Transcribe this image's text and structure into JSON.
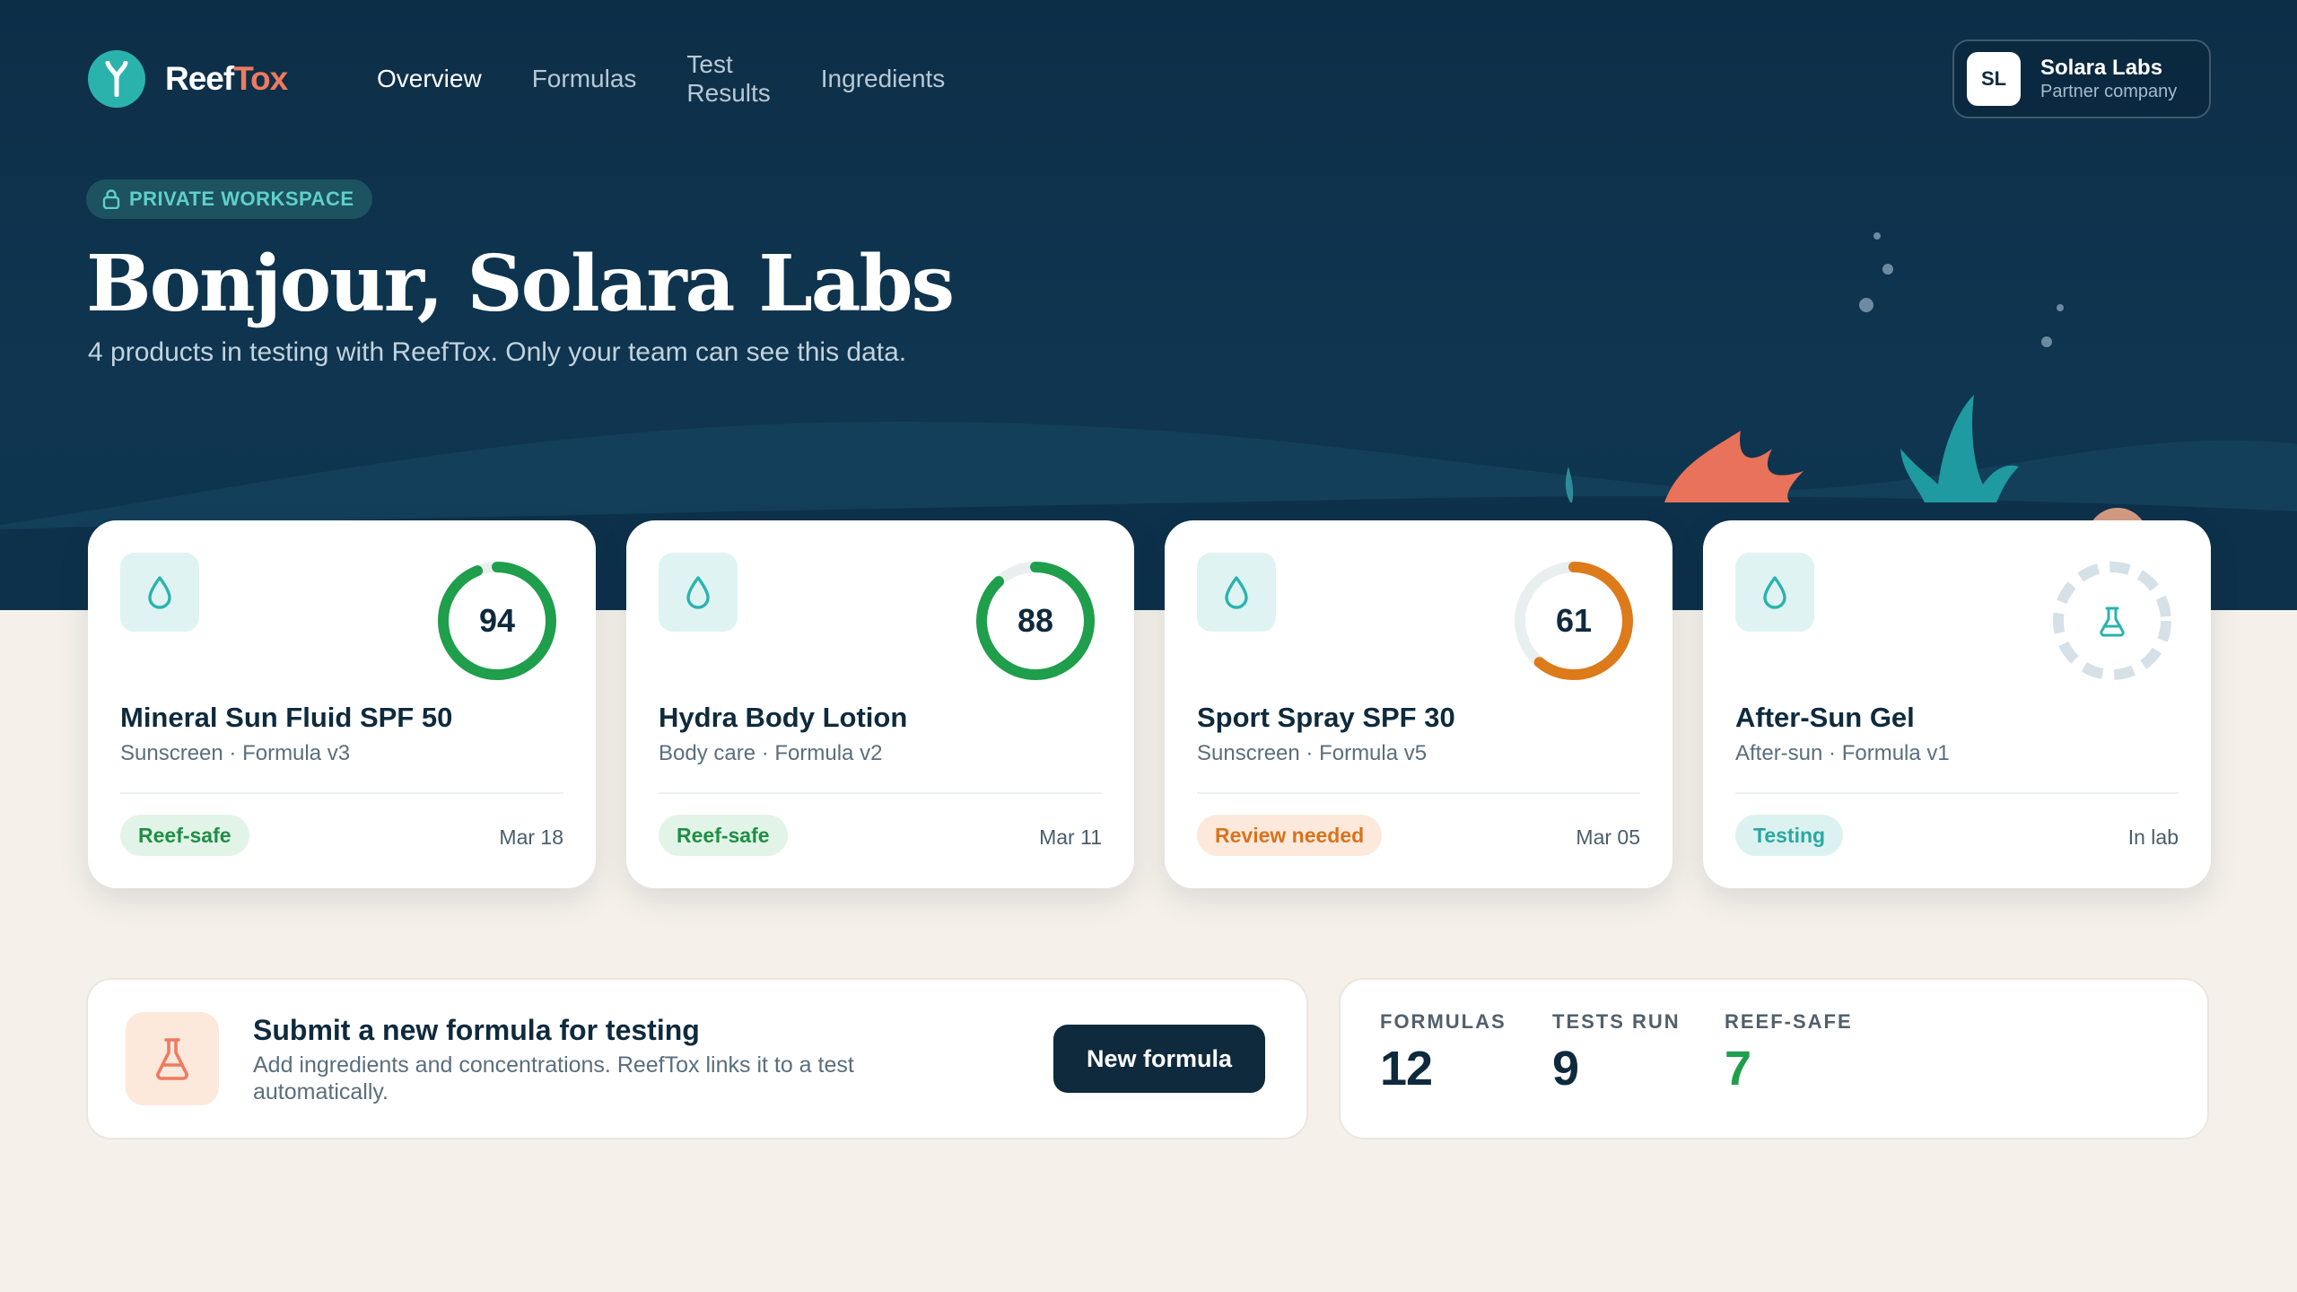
{
  "brand": {
    "name_part1": "Reef",
    "name_part2": "Tox",
    "accent": "#2ab3ad",
    "accent2": "#ee7a5f"
  },
  "nav": {
    "items": [
      {
        "label": "Overview",
        "active": true
      },
      {
        "label": "Formulas",
        "active": false
      },
      {
        "label": "Test Results",
        "active": false
      },
      {
        "label": "Ingredients",
        "active": false
      }
    ]
  },
  "account": {
    "initials": "SL",
    "name": "Solara Labs",
    "subtitle": "Partner company"
  },
  "hero": {
    "badge": "PRIVATE WORKSPACE",
    "greeting": "Bonjour, Solara Labs",
    "subtitle": "4 products in testing with ReefTox. Only your team can see this data."
  },
  "products": [
    {
      "name": "Mineral Sun Fluid SPF 50",
      "meta": "Sunscreen · Formula v3",
      "score": "94",
      "score_fraction": 0.94,
      "ring_color": "#1f9e4b",
      "status": "Reef-safe",
      "status_kind": "safe",
      "date": "Mar 18",
      "icon": "droplet-icon"
    },
    {
      "name": "Hydra Body Lotion",
      "meta": "Body care · Formula v2",
      "score": "88",
      "score_fraction": 0.88,
      "ring_color": "#1f9e4b",
      "status": "Reef-safe",
      "status_kind": "safe",
      "date": "Mar 11",
      "icon": "droplet-icon"
    },
    {
      "name": "Sport Spray SPF 30",
      "meta": "Sunscreen · Formula v5",
      "score": "61",
      "score_fraction": 0.61,
      "ring_color": "#dd7a1a",
      "status": "Review needed",
      "status_kind": "review",
      "date": "Mar 05",
      "icon": "droplet-icon"
    },
    {
      "name": "After-Sun Gel",
      "meta": "After-sun · Formula v1",
      "score": "",
      "score_fraction": null,
      "ring_color": "#d6e0e7",
      "status": "Testing",
      "status_kind": "testing",
      "date": "In lab",
      "icon": "droplet-icon"
    }
  ],
  "submit": {
    "title": "Submit a new formula for testing",
    "description": "Add ingredients and concentrations. ReefTox links it to a test automatically.",
    "button": "New formula"
  },
  "stats": [
    {
      "label": "FORMULAS",
      "value": "12",
      "color": "#0f2a3d"
    },
    {
      "label": "TESTS RUN",
      "value": "9",
      "color": "#0f2a3d"
    },
    {
      "label": "REEF-SAFE",
      "value": "7",
      "color": "#1f9e4b"
    }
  ]
}
